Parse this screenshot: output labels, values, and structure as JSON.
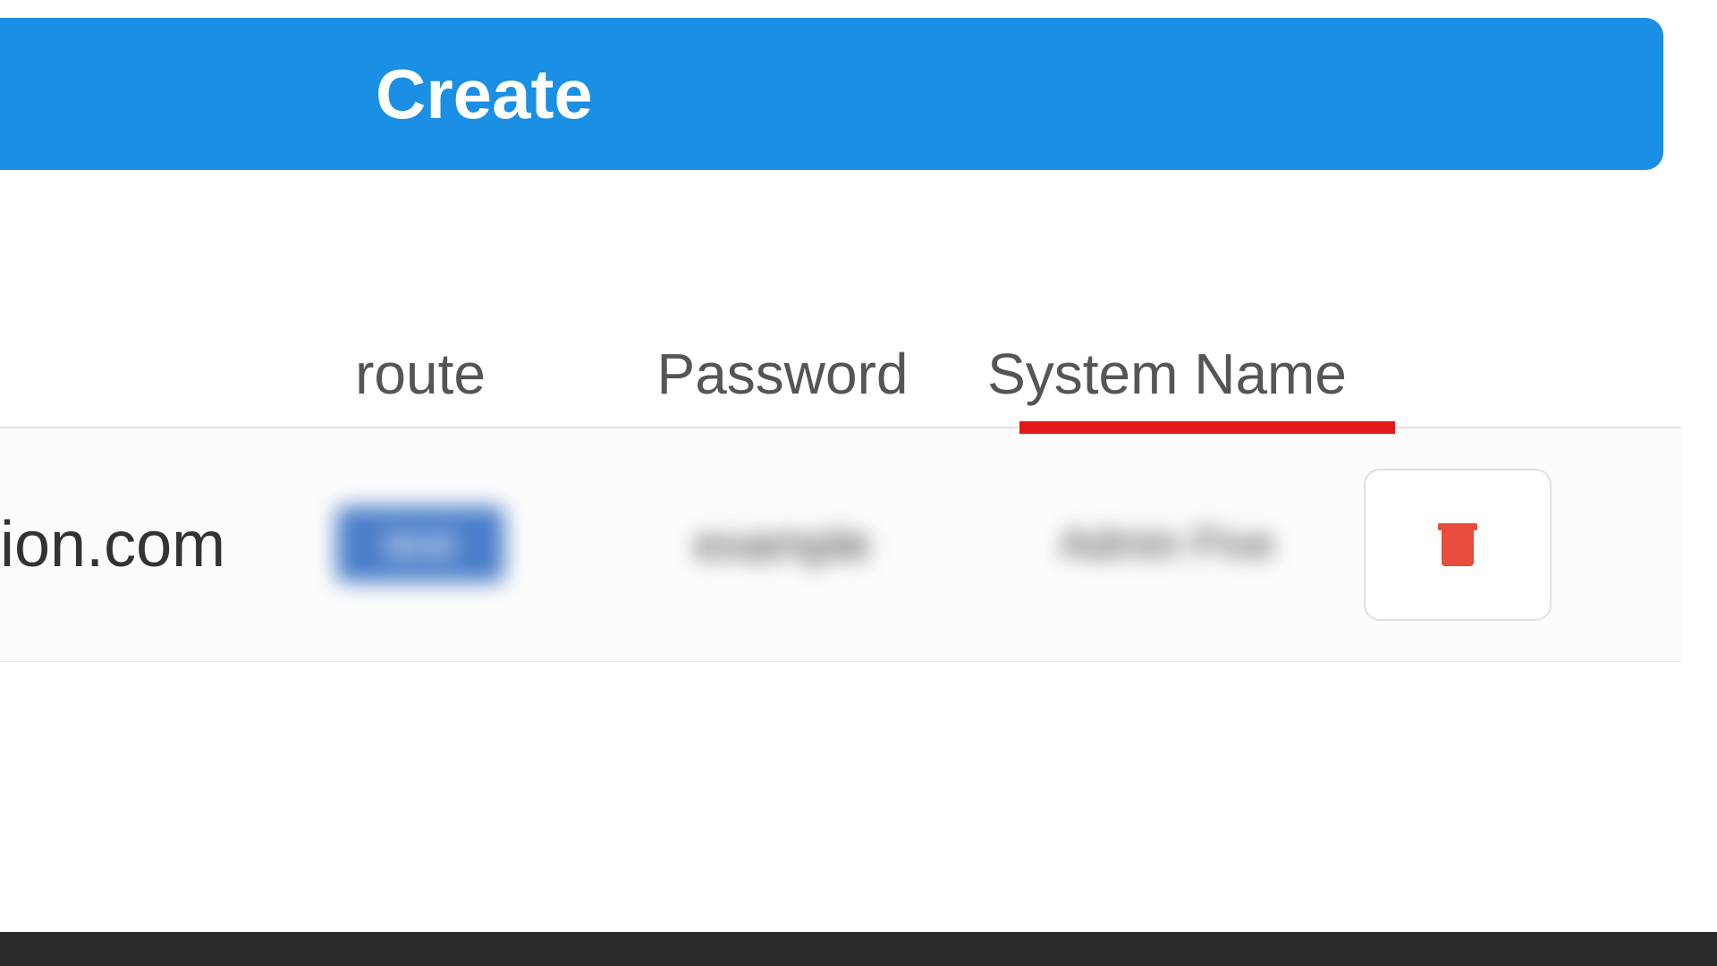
{
  "create_button": {
    "label": "Create"
  },
  "table": {
    "headers": {
      "route": "route",
      "password": "Password",
      "system_name": "System Name"
    },
    "rows": [
      {
        "domain": "ion.com",
        "route": "test",
        "password": "example",
        "system_name": "Admin Five"
      }
    ]
  },
  "icons": {
    "trash": "trash-icon"
  },
  "colors": {
    "primary": "#1a8fe3",
    "danger": "#e74c3c",
    "annotation": "#e31818"
  }
}
